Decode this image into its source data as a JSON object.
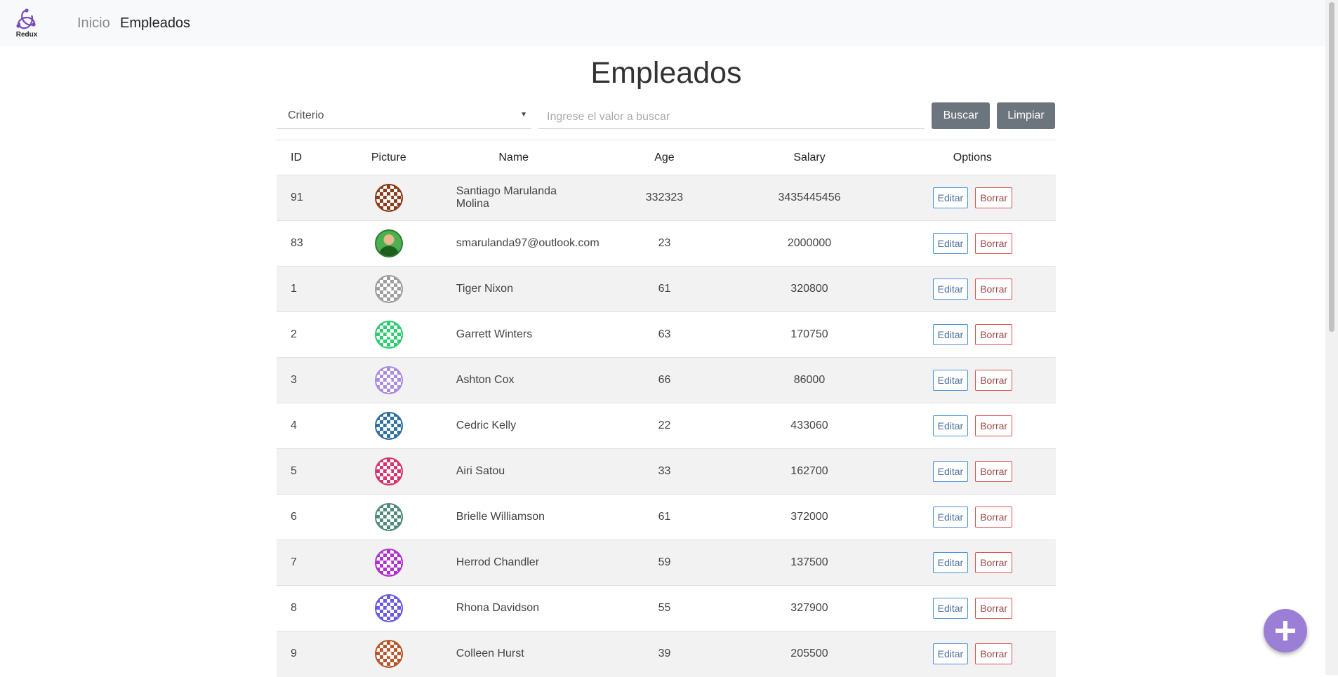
{
  "nav": {
    "logo_text": "Redux",
    "links": [
      "Inicio",
      "Empleados"
    ]
  },
  "page": {
    "title": "Empleados"
  },
  "filters": {
    "criterio_label": "Criterio",
    "search_placeholder": "Ingrese el valor a buscar",
    "buscar_label": "Buscar",
    "limpiar_label": "Limpiar"
  },
  "table": {
    "headers": [
      "ID",
      "Picture",
      "Name",
      "Age",
      "Salary",
      "Options"
    ],
    "rows": [
      {
        "id": "91",
        "name": "Santiago Marulanda Molina",
        "age": "332323",
        "salary": "3435445456",
        "avatar_color": "#8b3a1a"
      },
      {
        "id": "83",
        "name": "smarulanda97@outlook.com",
        "age": "23",
        "salary": "2000000",
        "avatar_color": "#2e7d32"
      },
      {
        "id": "1",
        "name": "Tiger Nixon",
        "age": "61",
        "salary": "320800",
        "avatar_color": "#9e9e9e"
      },
      {
        "id": "2",
        "name": "Garrett Winters",
        "age": "63",
        "salary": "170750",
        "avatar_color": "#2ecc71"
      },
      {
        "id": "3",
        "name": "Ashton Cox",
        "age": "66",
        "salary": "86000",
        "avatar_color": "#a98be0"
      },
      {
        "id": "4",
        "name": "Cedric Kelly",
        "age": "22",
        "salary": "433060",
        "avatar_color": "#2f6f9f"
      },
      {
        "id": "5",
        "name": "Airi Satou",
        "age": "33",
        "salary": "162700",
        "avatar_color": "#d6336c"
      },
      {
        "id": "6",
        "name": "Brielle Williamson",
        "age": "61",
        "salary": "372000",
        "avatar_color": "#4f8a7a"
      },
      {
        "id": "7",
        "name": "Herrod Chandler",
        "age": "59",
        "salary": "137500",
        "avatar_color": "#b02fd0"
      },
      {
        "id": "8",
        "name": "Rhona Davidson",
        "age": "55",
        "salary": "327900",
        "avatar_color": "#6a5ae0"
      },
      {
        "id": "9",
        "name": "Colleen Hurst",
        "age": "39",
        "salary": "205500",
        "avatar_color": "#b5562b"
      }
    ],
    "edit_label": "Editar",
    "delete_label": "Borrar"
  },
  "colors": {
    "accent": "#9b7fd6",
    "gray_button": "#6c757d",
    "edit_border": "#4a90d9",
    "delete_border": "#d9534f"
  },
  "icons": {
    "logo": "redux-logo-icon",
    "fab": "plus-icon",
    "select": "caret-down-icon"
  }
}
